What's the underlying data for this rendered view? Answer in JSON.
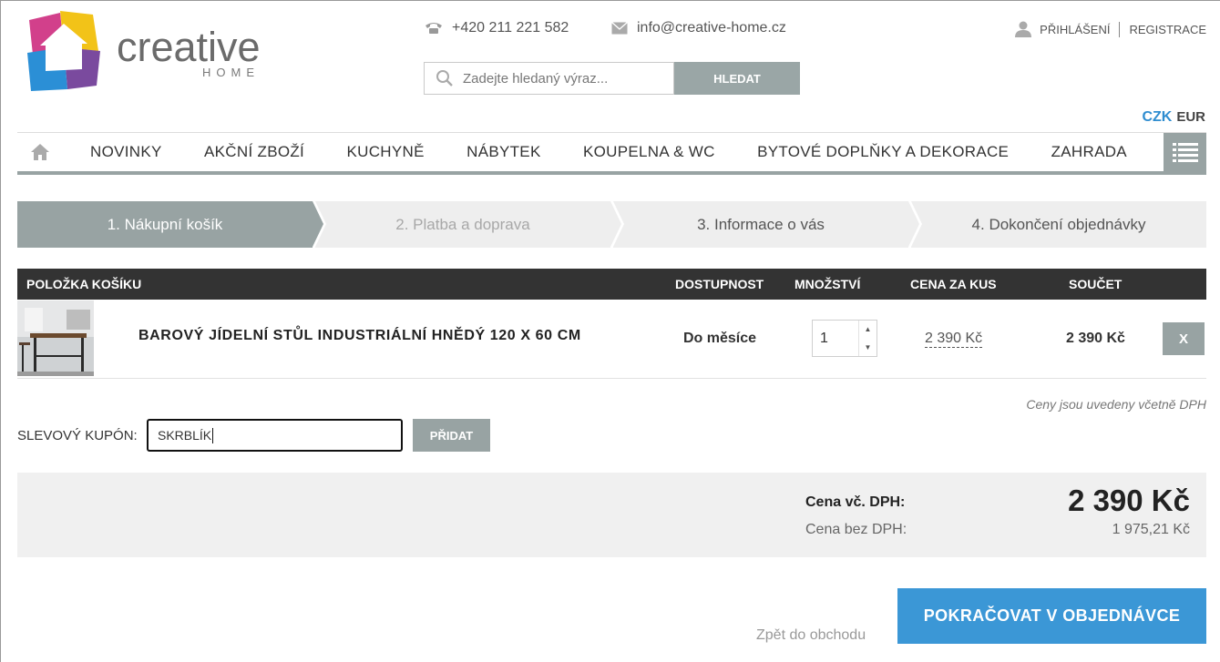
{
  "brand": {
    "name": "creative",
    "sub": "HOME"
  },
  "contact": {
    "phone": "+420 211 221 582",
    "email": "info@creative-home.cz"
  },
  "auth": {
    "login": "PŘIHLÁŠENÍ",
    "register": "REGISTRACE"
  },
  "search": {
    "placeholder": "Zadejte hledaný výraz...",
    "button": "HLEDAT"
  },
  "currency": {
    "active": "CZK",
    "other": "EUR"
  },
  "nav": {
    "items": [
      "NOVINKY",
      "AKČNÍ ZBOŽÍ",
      "KUCHYNĚ",
      "NÁBYTEK",
      "KOUPELNA & WC",
      "BYTOVÉ DOPLŇKY A DEKORACE",
      "ZAHRADA"
    ]
  },
  "steps": [
    "1. Nákupní košík",
    "2. Platba a doprava",
    "3. Informace o vás",
    "4. Dokončení objednávky"
  ],
  "table": {
    "headers": {
      "item": "POLOŽKA KOŠÍKU",
      "availability": "DOSTUPNOST",
      "quantity": "MNOŽSTVÍ",
      "unit_price": "CENA ZA KUS",
      "total": "SOUČET"
    },
    "rows": [
      {
        "name": "BAROVÝ JÍDELNÍ STŮL INDUSTRIÁLNÍ HNĚDÝ 120 X 60 CM",
        "availability": "Do měsíce",
        "quantity": "1",
        "unit_price": "2 390 Kč",
        "total": "2 390 Kč",
        "remove": "X"
      }
    ]
  },
  "vat_note": "Ceny jsou uvedeny včetně DPH",
  "coupon": {
    "label": "SLEVOVÝ KUPÓN:",
    "value": "SKRBLÍK",
    "button": "PŘIDAT"
  },
  "summary": {
    "with_vat_label": "Cena vč. DPH:",
    "with_vat": "2 390 Kč",
    "without_vat_label": "Cena bez DPH:",
    "without_vat": "1 975,21 Kč"
  },
  "actions": {
    "back": "Zpět do obchodu",
    "continue": "POKRAČOVAT V OBJEDNÁVCE"
  },
  "colors": {
    "accent": "#3b97d6",
    "gray_button": "#98a3a3",
    "header_dark": "#333333"
  }
}
